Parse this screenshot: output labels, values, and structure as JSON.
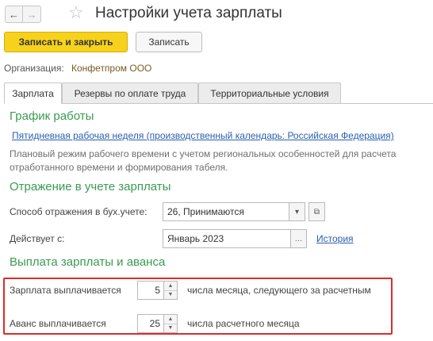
{
  "window": {
    "title": "Настройки учета зарплаты",
    "icons": {
      "back": "arrow-left-icon",
      "forward": "arrow-right-icon",
      "favorite": "star-icon"
    }
  },
  "toolbar": {
    "save_close_label": "Записать и закрыть",
    "save_label": "Записать"
  },
  "organization": {
    "label": "Организация:",
    "value": "Конфетпром ООО"
  },
  "tabs": [
    {
      "label": "Зарплата",
      "active": true
    },
    {
      "label": "Резервы по оплате труда",
      "active": false
    },
    {
      "label": "Территориальные условия",
      "active": false
    }
  ],
  "schedule": {
    "title": "График работы",
    "link": "Пятидневная рабочая неделя (производственный календарь: Российская Федерация)",
    "description": "Плановый режим рабочего времени с учетом региональных особенностей для расчета отработанного времени и формирования табеля."
  },
  "accounting": {
    "title": "Отражение в учете зарплаты",
    "method_label": "Способ отражения в бух.учете:",
    "method_value": "26, Принимаются",
    "effective_label": "Действует с:",
    "effective_value": "Январь 2023",
    "history_link": "История"
  },
  "payment": {
    "title": "Выплата зарплаты и аванса",
    "salary_label": "Зарплата выплачивается",
    "salary_day": "5",
    "salary_suffix": "числа месяца, следующего за расчетным",
    "advance_label": "Аванс выплачивается",
    "advance_day": "25",
    "advance_suffix": "числа расчетного месяца"
  },
  "colors": {
    "accent": "#f6d21c",
    "section_title": "#3a9a54",
    "link": "#2a5fb0",
    "highlight": "#dd2b2b"
  }
}
